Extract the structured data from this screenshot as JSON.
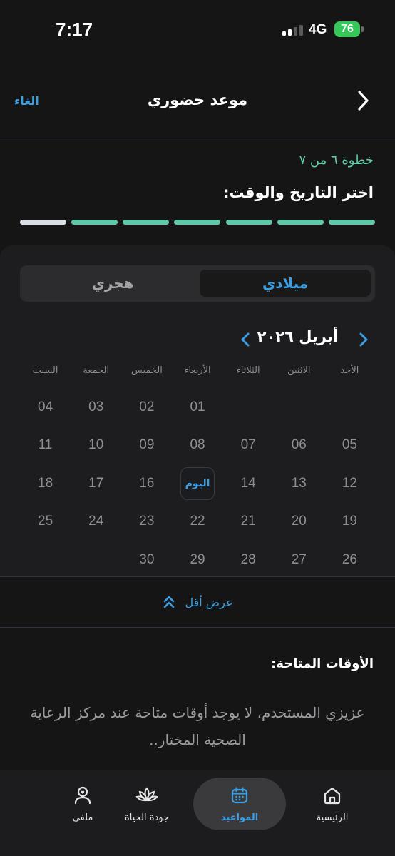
{
  "status_bar": {
    "time": "7:17",
    "network": "4G",
    "battery": "76"
  },
  "header": {
    "title": "موعد حضوري",
    "cancel_label": "الغاء"
  },
  "step": {
    "text": "خطوة ٦ من ٧",
    "heading": "اختر التاريخ والوقت:",
    "total": 7,
    "current": 6
  },
  "calendar_toggle": {
    "gregorian_label": "ميلادي",
    "hijri_label": "هجري",
    "selected": "ميلادي"
  },
  "calendar": {
    "month_label": "أبريل ٢٠٢٦",
    "weekdays": [
      "الأحد",
      "الاثنين",
      "الثلاثاء",
      "الأربعاء",
      "الخميس",
      "الجمعة",
      "السبت"
    ],
    "weeks": [
      [
        "",
        "",
        "",
        "01",
        "02",
        "03",
        "04"
      ],
      [
        "05",
        "06",
        "07",
        "08",
        "09",
        "10",
        "11"
      ],
      [
        "12",
        "13",
        "14",
        "اليوم",
        "16",
        "17",
        "18"
      ],
      [
        "19",
        "20",
        "21",
        "22",
        "23",
        "24",
        "25"
      ],
      [
        "26",
        "27",
        "28",
        "29",
        "30",
        "",
        ""
      ]
    ],
    "today_label": "اليوم",
    "show_less_label": "عرض أقل"
  },
  "available_times": {
    "title": "الأوقات المتاحة:",
    "empty_message": "عزيزي المستخدم، لا يوجد أوقات متاحة عند مركز الرعاية الصحية المختار.."
  },
  "bottom_nav": {
    "items": [
      {
        "label": "الرئيسية",
        "icon": "home-icon"
      },
      {
        "label": "المواعيد",
        "icon": "calendar-icon",
        "active": true
      },
      {
        "label": "جودة الحياة",
        "icon": "lotus-icon"
      },
      {
        "label": "ملفي",
        "icon": "profile-heart-icon"
      }
    ]
  },
  "colors": {
    "accent": "#3b9ee3",
    "progress": "#5ec9a8",
    "progress_current": "#d9dde6",
    "background": "#151515"
  }
}
